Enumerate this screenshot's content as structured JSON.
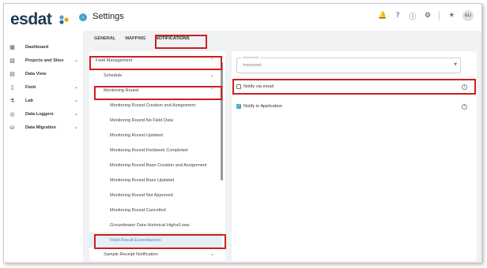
{
  "brand": {
    "logo_text": "esdat"
  },
  "topbar": {
    "title": "Settings",
    "avatar_initials": "EU"
  },
  "sidebar": {
    "items": [
      {
        "label": "Dashboard",
        "icon": "dashboard-icon",
        "has_chevron": false
      },
      {
        "label": "Projects and Sites",
        "icon": "projects-icon",
        "has_chevron": true
      },
      {
        "label": "Data View",
        "icon": "data-view-icon",
        "has_chevron": false
      },
      {
        "label": "Field",
        "icon": "field-icon",
        "has_chevron": true
      },
      {
        "label": "Lab",
        "icon": "lab-icon",
        "has_chevron": true
      },
      {
        "label": "Data Loggers",
        "icon": "data-loggers-icon",
        "has_chevron": true
      },
      {
        "label": "Data Migration",
        "icon": "data-migration-icon",
        "has_chevron": true
      }
    ]
  },
  "tabs": [
    {
      "label": "GENERAL"
    },
    {
      "label": "MAPPING"
    },
    {
      "label": "NOTIFICATIONS",
      "active": true
    }
  ],
  "tree": [
    {
      "label": "Field Management",
      "level": 0,
      "chevron": "up"
    },
    {
      "label": "Schedule",
      "level": 1,
      "chevron": "down"
    },
    {
      "label": "Monitoring Round",
      "level": 1,
      "chevron": "up"
    },
    {
      "label": "Monitoring Round Creation and Assignment",
      "level": 2
    },
    {
      "label": "Monitoring Round No Field Data",
      "level": 2
    },
    {
      "label": "Monitoring Round Updated",
      "level": 2
    },
    {
      "label": "Monitoring Round Fieldwork Completed",
      "level": 2
    },
    {
      "label": "Monitoring Round Base Creation and Assignment",
      "level": 2
    },
    {
      "label": "Monitoring Round Base Updated",
      "level": 2
    },
    {
      "label": "Monitoring Round Not Approved",
      "level": 2
    },
    {
      "label": "Monitoring Round Cancelled",
      "level": 2
    },
    {
      "label": "Groundwater Data Historical Highs/Lows",
      "level": 2
    },
    {
      "label": "Field Result Exceedances",
      "level": 2,
      "selected": true
    },
    {
      "label": "Sample Receipt Notification",
      "level": 1,
      "chevron": "down"
    }
  ],
  "importance": {
    "label": "Importance",
    "value": "Important"
  },
  "notify_email": {
    "label": "Notify via email",
    "checked": false
  },
  "notify_app": {
    "label": "Notify in Application",
    "checked": true
  },
  "colors": {
    "accent": "#4aa3c9",
    "highlight": "#cc1f1f",
    "brand": "#1f3a4d"
  }
}
